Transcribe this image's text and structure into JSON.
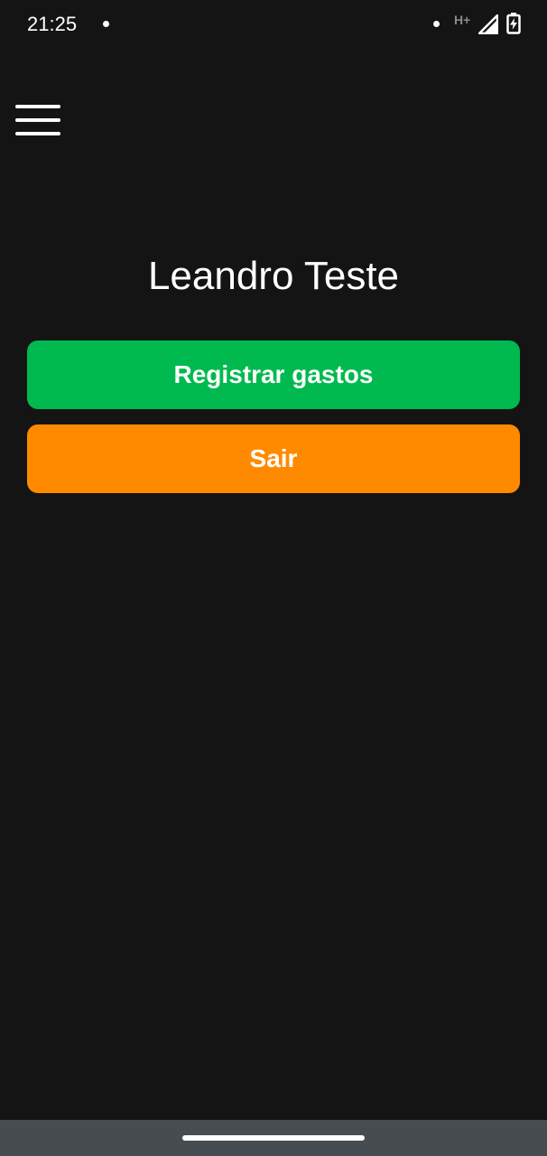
{
  "status_bar": {
    "time": "21:25",
    "network_type": "H+",
    "icons": [
      "notification-dot-icon",
      "signal-icon",
      "battery-charging-icon"
    ]
  },
  "header": {
    "menu_icon": "hamburger-menu-icon"
  },
  "main": {
    "user_name": "Leandro Teste",
    "register_button_label": "Registrar gastos",
    "logout_button_label": "Sair"
  },
  "colors": {
    "background": "#141414",
    "register_button": "#00b94f",
    "logout_button": "#ff8a00",
    "nav_bar": "#464c50",
    "text": "#ffffff"
  }
}
